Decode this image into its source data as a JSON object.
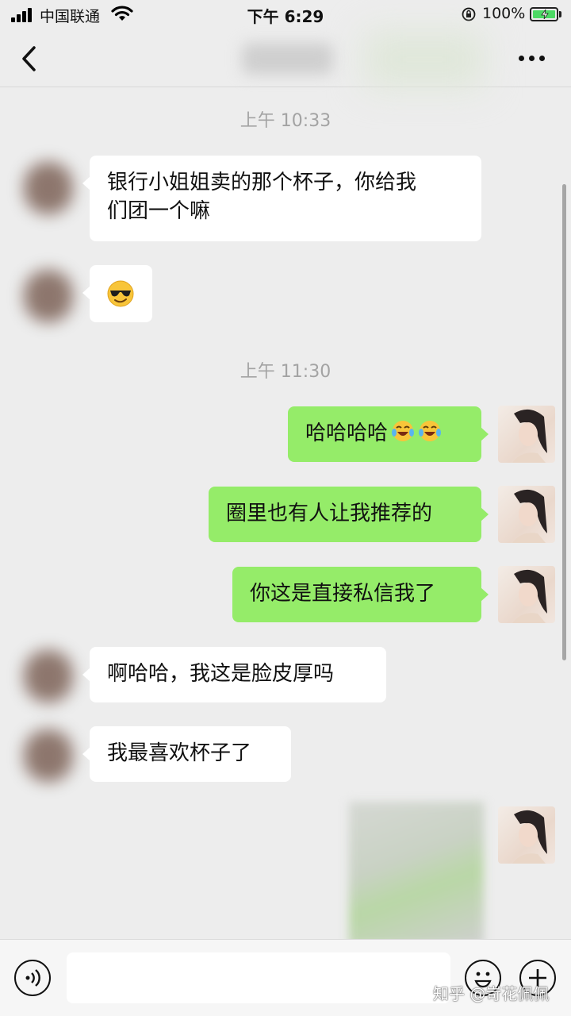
{
  "status_bar": {
    "carrier": "中国联通",
    "time": "下午 6:29",
    "battery_pct": "100%",
    "battery_level": 1.0
  },
  "nav": {
    "back_icon": "chevron-left-icon",
    "more_icon": "more-dots-icon"
  },
  "timestamps": [
    "上午 10:33",
    "上午 11:30"
  ],
  "messages": [
    {
      "side": "left",
      "text": "银行小姐姐卖的那个杯子，你给我\n们团一个嘛"
    },
    {
      "side": "left",
      "emoji": "sunglasses-emoji"
    },
    {
      "side": "right",
      "text": "哈哈哈哈",
      "emoji": "tears-of-joy-emoji"
    },
    {
      "side": "right",
      "text": "圈里也有人让我推荐的"
    },
    {
      "side": "right",
      "text": "你这是直接私信我了"
    },
    {
      "side": "left",
      "text": "啊哈哈，我这是脸皮厚吗"
    },
    {
      "side": "left",
      "text": "我最喜欢杯子了"
    },
    {
      "side": "right",
      "type": "image"
    }
  ],
  "input_bar": {
    "voice_icon": "voice-icon",
    "emoji_icon": "emoji-icon",
    "plus_icon": "plus-icon"
  },
  "watermark": "知乎 @岢花佩佩",
  "colors": {
    "background": "#ededed",
    "bubble_self": "#95ec69",
    "bubble_other": "#ffffff",
    "timestamp": "#a3a3a3"
  }
}
